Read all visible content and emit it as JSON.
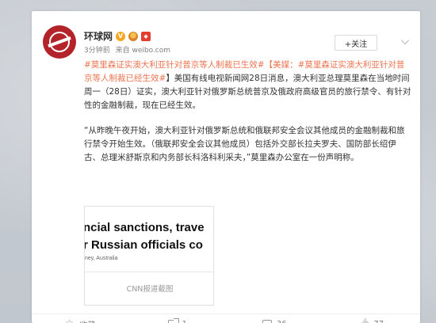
{
  "account": {
    "name": "环球网",
    "meta_time": "3分钟前",
    "meta_source": "来自 weibo.com"
  },
  "follow_button": {
    "label": "+关注"
  },
  "post": {
    "para1_tags": "#莫里森证实澳大利亚针对普京等人制裁已生效#",
    "para1_tag2": "【美媒：#莫里森证实澳大利亚针对普京等人制裁已经生效#",
    "para1_text": "】美国有线电视新闻网28日消息，澳大利亚总理莫里森在当地时间周一（28日）证实，澳大利亚针对俄罗斯总统普京及俄政府高级官员的旅行禁令、有针对性的金融制裁，现在已经生效。",
    "para2_text": "“从昨晚午夜开始，澳大利亚针对俄罗斯总统和俄联邦安全会议其他成员的金融制裁和旅行禁令开始生效。（俄联邦安全会议其他成员）包括外交部长拉夫罗夫、国防部长绍伊古、总理米舒斯京和内务部长科洛科利采夫，”莫里森办公室在一份声明称。"
  },
  "image": {
    "line1": "ncial sanctions, trave",
    "line2": "r Russian officials co",
    "line3": "ney, Australia",
    "caption": "CNN报道截图"
  },
  "actions": {
    "favorite_label": "收藏",
    "repost_count": "1",
    "comment_count": "36",
    "like_count": "77"
  },
  "colors": {
    "tag": "#eb7350",
    "avatar_red": "#b3232a"
  }
}
